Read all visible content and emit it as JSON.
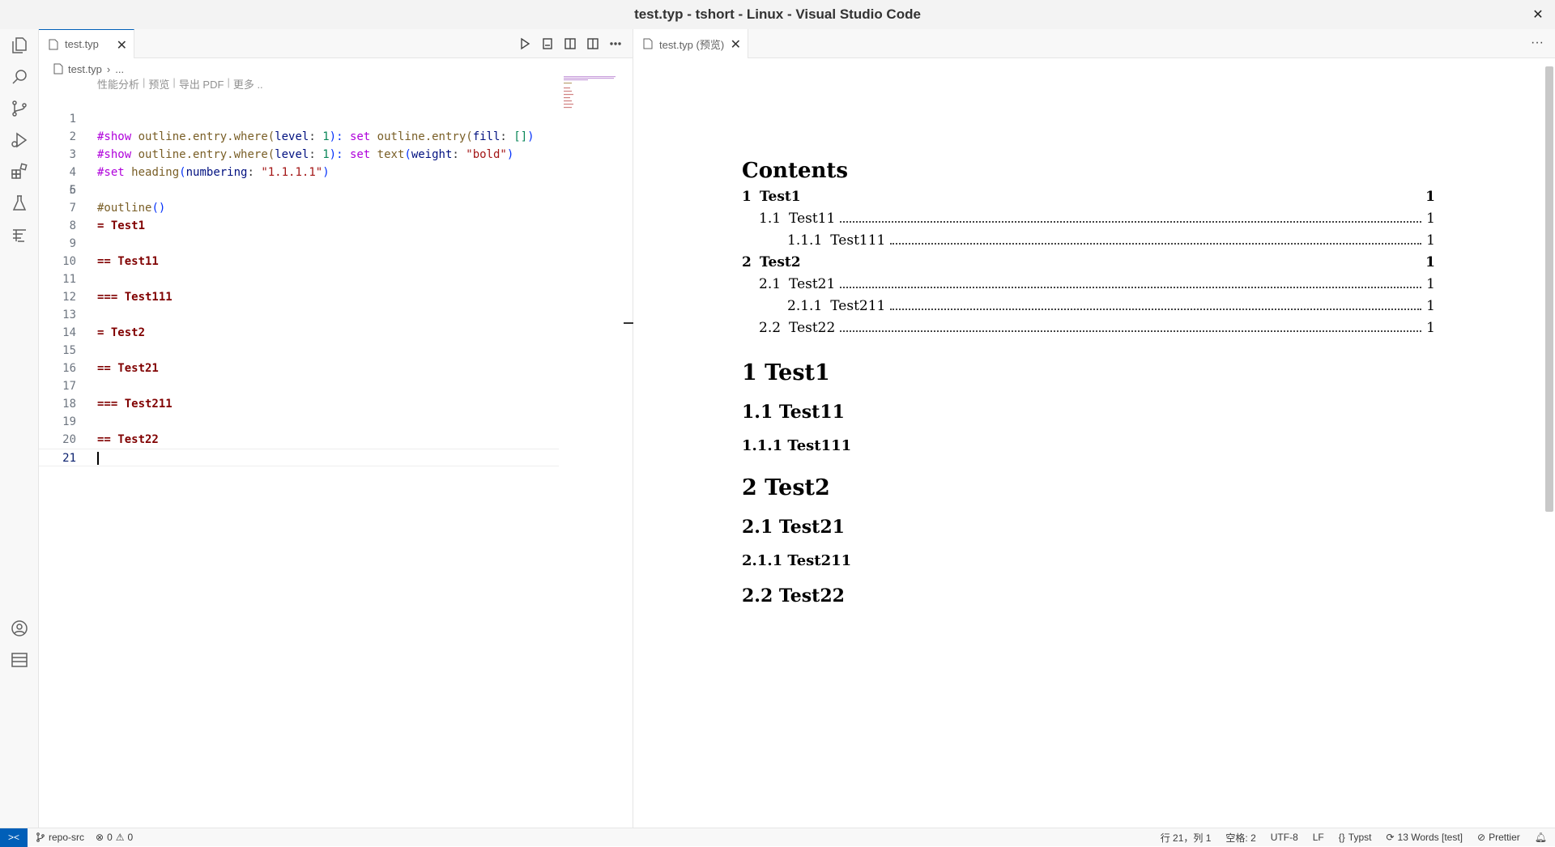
{
  "window": {
    "title": "test.typ - tshort - Linux - Visual Studio Code",
    "close_glyph": "✕"
  },
  "activity_bar": {
    "items": [
      "explorer-icon",
      "search-icon",
      "source-control-icon",
      "run-debug-icon",
      "extensions-icon",
      "testing-icon",
      "typst-icon"
    ],
    "bottom": [
      "account-icon",
      "manage-icon"
    ]
  },
  "editor": {
    "tab": {
      "label": "test.typ",
      "close": "✕"
    },
    "breadcrumb": {
      "file": "test.typ",
      "sep": "›",
      "more": "..."
    },
    "codelens": {
      "profile": "性能分析",
      "preview": "预览",
      "export": "导出 PDF",
      "more": "更多 ..",
      "sep": "|"
    },
    "lines": [
      {
        "n": "1"
      },
      {
        "n": "2"
      },
      {
        "n": "3"
      },
      {
        "n": "4"
      },
      {
        "n": "5"
      },
      {
        "n": "6"
      },
      {
        "n": "7"
      },
      {
        "n": "8",
        "text": "= Test1"
      },
      {
        "n": "9"
      },
      {
        "n": "10",
        "text": "== Test11"
      },
      {
        "n": "11"
      },
      {
        "n": "12",
        "text": "=== Test111"
      },
      {
        "n": "13"
      },
      {
        "n": "14",
        "text": "= Test2"
      },
      {
        "n": "15"
      },
      {
        "n": "16",
        "text": "== Test21"
      },
      {
        "n": "17"
      },
      {
        "n": "18",
        "text": "=== Test211"
      },
      {
        "n": "19"
      },
      {
        "n": "20",
        "text": "== Test22"
      },
      {
        "n": "21"
      }
    ],
    "code": {
      "l1": {
        "a": "#show",
        "b": "outline",
        "c": ".entry.where(",
        "d": "level",
        "e": ": ",
        "f": "1",
        "g": "): ",
        "h": "set",
        "i": "outline",
        "j": ".entry(",
        "k": "fill",
        "l": ": ",
        "m": "[]",
        "n": ")"
      },
      "l2": {
        "a": "#show",
        "b": "outline",
        "c": ".entry.where(",
        "d": "level",
        "e": ": ",
        "f": "1",
        "g": "): ",
        "h": "set",
        "i": "text",
        "j": "(",
        "k": "weight",
        "l": ": ",
        "m": "\"bold\"",
        "n": ")"
      },
      "l3": {
        "a": "#set",
        "b": "heading",
        "c": "(",
        "d": "numbering",
        "e": ": ",
        "f": "\"1.1.1.1\"",
        "g": ")"
      },
      "l5": {
        "a": "#outline",
        "b": "()"
      }
    }
  },
  "preview": {
    "tab": {
      "label": "test.typ (预览)",
      "close": "✕"
    },
    "more": "···",
    "contents_title": "Contents",
    "toc": [
      {
        "level": 1,
        "num": "1",
        "title": "Test1",
        "page": "1"
      },
      {
        "level": 2,
        "num": "1.1",
        "title": "Test11",
        "page": "1"
      },
      {
        "level": 3,
        "num": "1.1.1",
        "title": "Test111",
        "page": "1"
      },
      {
        "level": 1,
        "num": "2",
        "title": "Test2",
        "page": "1"
      },
      {
        "level": 2,
        "num": "2.1",
        "title": "Test21",
        "page": "1"
      },
      {
        "level": 3,
        "num": "2.1.1",
        "title": "Test211",
        "page": "1"
      },
      {
        "level": 2,
        "num": "2.2",
        "title": "Test22",
        "page": "1"
      }
    ],
    "headings": [
      {
        "level": 1,
        "text": "1 Test1"
      },
      {
        "level": 2,
        "text": "1.1 Test11"
      },
      {
        "level": 3,
        "text": "1.1.1 Test111"
      },
      {
        "level": 1,
        "text": "2 Test2"
      },
      {
        "level": 2,
        "text": "2.1 Test21"
      },
      {
        "level": 3,
        "text": "2.1.1 Test211"
      },
      {
        "level": 2,
        "text": "2.2 Test22"
      }
    ]
  },
  "statusbar": {
    "remote": "><",
    "branch": "repo-src",
    "errors": "0",
    "warnings": "0",
    "position": "行 21，列 1",
    "spaces": "空格: 2",
    "encoding": "UTF-8",
    "eol": "LF",
    "language": "Typst",
    "words": "13 Words [test]",
    "prettier": "Prettier"
  },
  "colors": {
    "accent": "#005fb8",
    "keyword": "#af00db",
    "heading": "#800000",
    "string": "#a31515",
    "number": "#098658"
  }
}
